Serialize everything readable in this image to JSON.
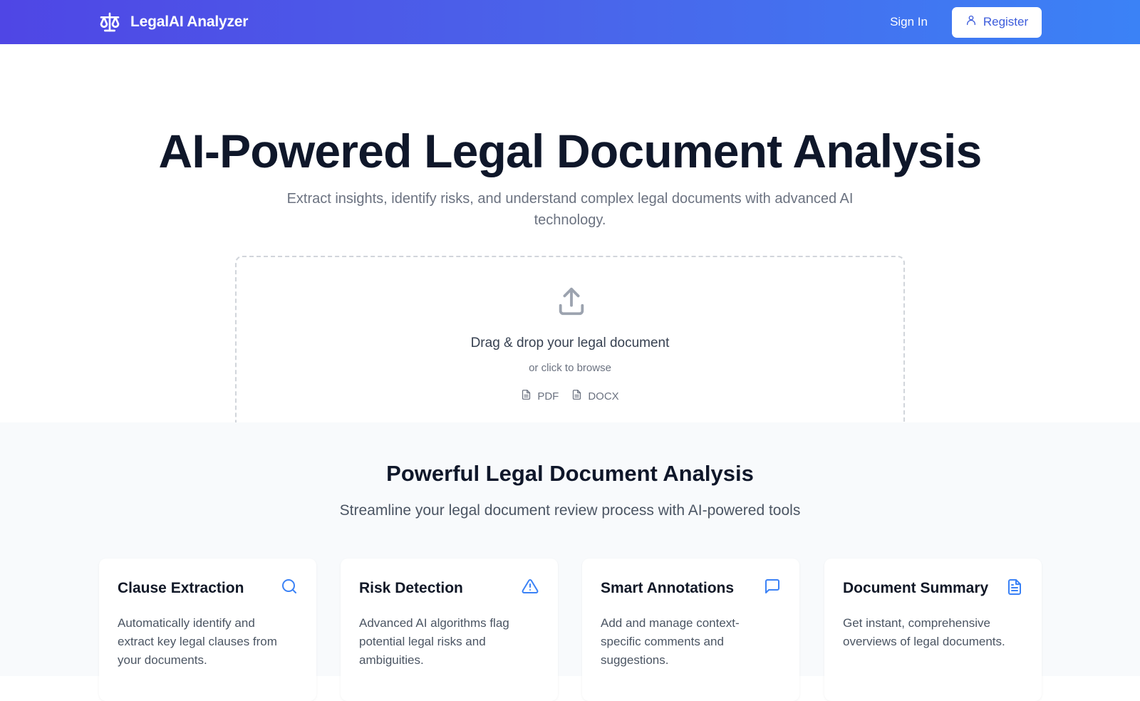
{
  "nav": {
    "brand": "LegalAI Analyzer",
    "sign_in": "Sign In",
    "register": "Register"
  },
  "hero": {
    "title": "AI-Powered Legal Document Analysis",
    "subtitle": "Extract insights, identify risks, and understand complex legal documents with advanced AI technology."
  },
  "upload": {
    "title": "Drag & drop your legal document",
    "subtitle": "or click to browse",
    "formats": [
      "PDF",
      "DOCX"
    ]
  },
  "features": {
    "title": "Powerful Legal Document Analysis",
    "subtitle": "Streamline your legal document review process with AI-powered tools",
    "cards": [
      {
        "title": "Clause Extraction",
        "icon": "search-icon",
        "description": "Automatically identify and extract key legal clauses from your documents."
      },
      {
        "title": "Risk Detection",
        "icon": "warning-icon",
        "description": "Advanced AI algorithms flag potential legal risks and ambiguities."
      },
      {
        "title": "Smart Annotations",
        "icon": "comment-icon",
        "description": "Add and manage context-specific comments and suggestions."
      },
      {
        "title": "Document Summary",
        "icon": "document-icon",
        "description": "Get instant, comprehensive overviews of legal documents."
      }
    ]
  },
  "colors": {
    "nav_gradient_start": "#4f46e5",
    "nav_gradient_end": "#3b82f6",
    "accent_blue": "#3b82f6",
    "heading": "#0f172a"
  }
}
